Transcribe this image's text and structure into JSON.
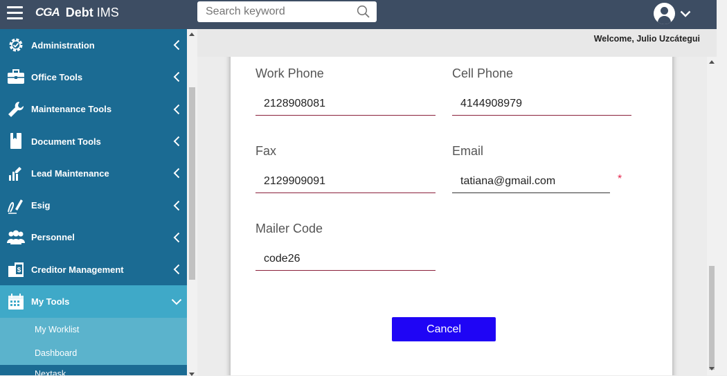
{
  "header": {
    "logo_mark": "CGA",
    "logo_name": "Debt",
    "logo_name2": "IMS",
    "search_placeholder": "Search keyword",
    "search_value": ""
  },
  "sidebar": {
    "items": [
      {
        "label": "Administration",
        "icon": "gear-check-icon"
      },
      {
        "label": "Office Tools",
        "icon": "briefcase-icon"
      },
      {
        "label": "Maintenance Tools",
        "icon": "wrench-icon"
      },
      {
        "label": "Document Tools",
        "icon": "book-icon"
      },
      {
        "label": "Lead Maintenance",
        "icon": "chart-edit-icon"
      },
      {
        "label": "Esig",
        "icon": "signature-icon"
      },
      {
        "label": "Personnel",
        "icon": "users-icon"
      },
      {
        "label": "Creditor Management",
        "icon": "money-building-icon"
      },
      {
        "label": "My Tools",
        "icon": "calendar-icon"
      }
    ],
    "submenu": [
      {
        "label": "My Worklist"
      },
      {
        "label": "Dashboard"
      },
      {
        "label": "Nextask"
      }
    ]
  },
  "welcome": "Welcome, Julio Uzcátegui",
  "form": {
    "work_phone": {
      "label": "Work Phone",
      "value": "2128908081"
    },
    "cell_phone": {
      "label": "Cell Phone",
      "value": "4144908979"
    },
    "fax": {
      "label": "Fax",
      "value": "2129909091"
    },
    "email": {
      "label": "Email",
      "value": "tatiana@gmail.com",
      "required_mark": "*"
    },
    "mailer_code": {
      "label": "Mailer Code",
      "value": "code26"
    },
    "cancel_label": "Cancel"
  },
  "colors": {
    "topbar": "#3d4d63",
    "sidebar": "#1b6b93",
    "sidebar_active": "#3fa9c8",
    "submenu": "#5bb3cc",
    "cancel_button": "#1f05f5",
    "input_underline": "#8a1f3a",
    "required": "#e4264d"
  }
}
